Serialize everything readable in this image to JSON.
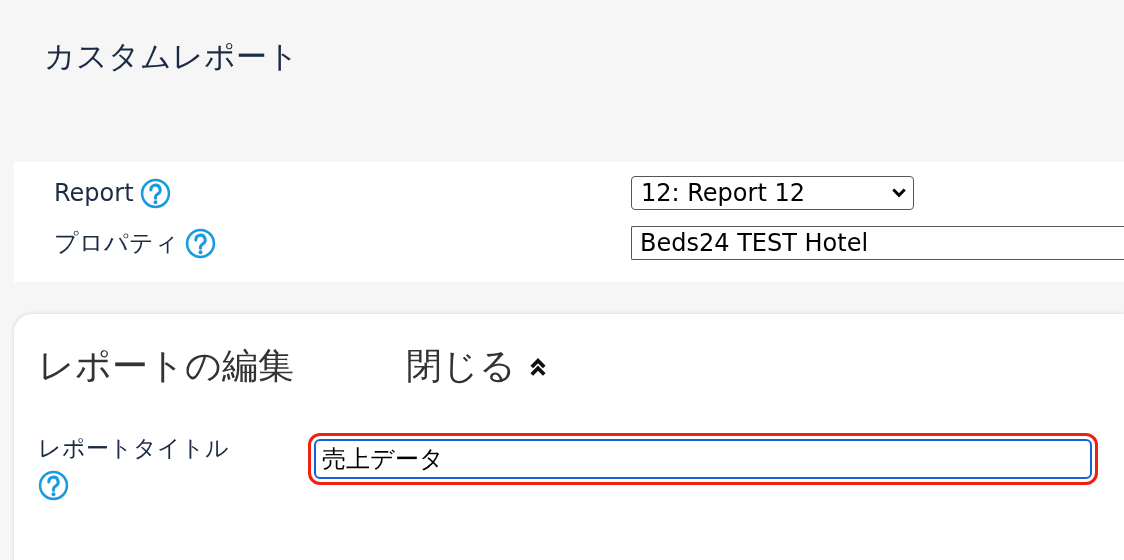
{
  "page_title": "カスタムレポート",
  "settings": [
    {
      "kind": "select",
      "label": "Report",
      "value": "12: Report 12"
    },
    {
      "kind": "text",
      "label": "プロパティ",
      "value": "Beds24 TEST Hotel"
    }
  ],
  "editor": {
    "title": "レポートの編集",
    "toggle": "閉じる",
    "expanded": true,
    "fields": [
      {
        "label": "レポートタイトル",
        "value": "売上データ",
        "highlighted": true
      }
    ]
  }
}
